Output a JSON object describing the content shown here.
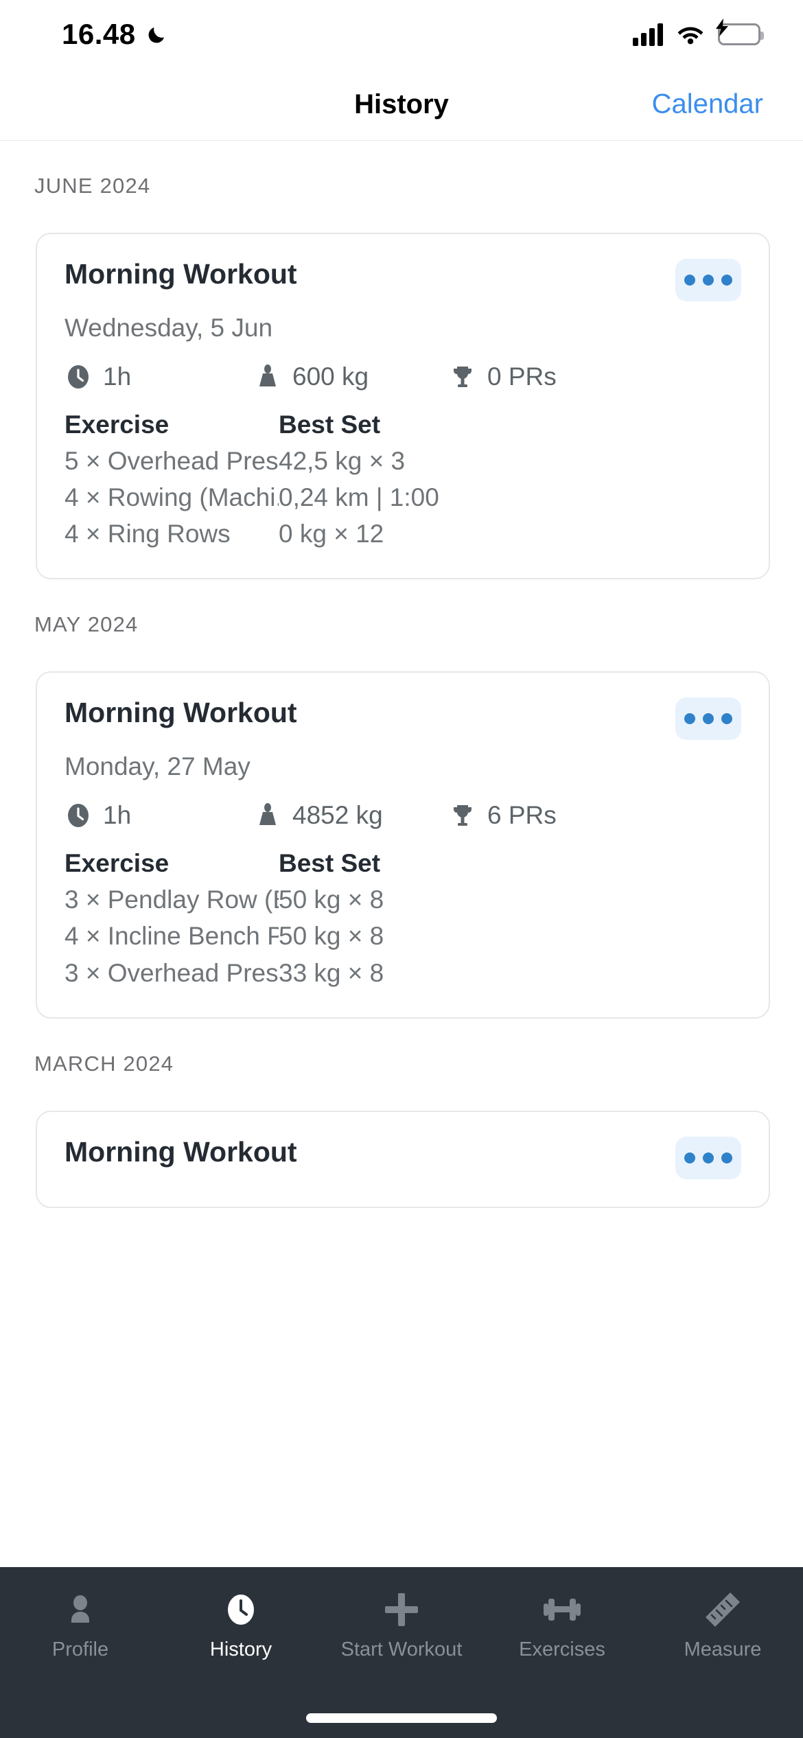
{
  "status_bar": {
    "time": "16.48",
    "dnd_icon": "moon-icon",
    "signal_icon": "cellular-signal-icon",
    "wifi_icon": "wifi-icon",
    "battery_icon": "battery-charging-icon",
    "battery_color": "#32d74b"
  },
  "header": {
    "title": "History",
    "action_label": "Calendar",
    "action_color": "#3b8ded"
  },
  "sections": [
    {
      "label": "JUNE 2024",
      "cards": [
        {
          "title": "Morning Workout",
          "date": "Wednesday, 5 Jun",
          "menu_icon": "ellipsis-icon",
          "stats": [
            {
              "icon": "clock-icon",
              "value": "1h"
            },
            {
              "icon": "weight-icon",
              "value": "600 kg"
            },
            {
              "icon": "trophy-icon",
              "value": "0 PRs"
            }
          ],
          "table": {
            "headers": [
              "Exercise",
              "Best Set"
            ],
            "rows": [
              [
                "5 × Overhead Pres...",
                "42,5 kg × 3"
              ],
              [
                "4 × Rowing (Machi...",
                "0,24 km | 1:00"
              ],
              [
                "4 × Ring Rows",
                "0 kg × 12"
              ]
            ]
          }
        }
      ]
    },
    {
      "label": "MAY 2024",
      "cards": [
        {
          "title": "Morning Workout",
          "date": "Monday, 27 May",
          "menu_icon": "ellipsis-icon",
          "stats": [
            {
              "icon": "clock-icon",
              "value": "1h"
            },
            {
              "icon": "weight-icon",
              "value": "4852 kg"
            },
            {
              "icon": "trophy-icon",
              "value": "6 PRs"
            }
          ],
          "table": {
            "headers": [
              "Exercise",
              "Best Set"
            ],
            "rows": [
              [
                "3 × Pendlay Row (B...",
                "50 kg × 8"
              ],
              [
                "4 × Incline Bench P...",
                "50 kg × 8"
              ],
              [
                "3 × Overhead Pres...",
                "33 kg × 8"
              ]
            ]
          }
        }
      ]
    },
    {
      "label": "MARCH 2024",
      "cards": [
        {
          "title": "Morning Workout",
          "menu_icon": "ellipsis-icon"
        }
      ]
    }
  ],
  "tabbar": {
    "background": "#2b3239",
    "items": [
      {
        "label": "Profile",
        "icon": "person-icon",
        "active": false
      },
      {
        "label": "History",
        "icon": "clock-icon",
        "active": true
      },
      {
        "label": "Start Workout",
        "icon": "plus-icon",
        "active": false
      },
      {
        "label": "Exercises",
        "icon": "dumbbell-icon",
        "active": false
      },
      {
        "label": "Measure",
        "icon": "ruler-icon",
        "active": false
      }
    ]
  }
}
